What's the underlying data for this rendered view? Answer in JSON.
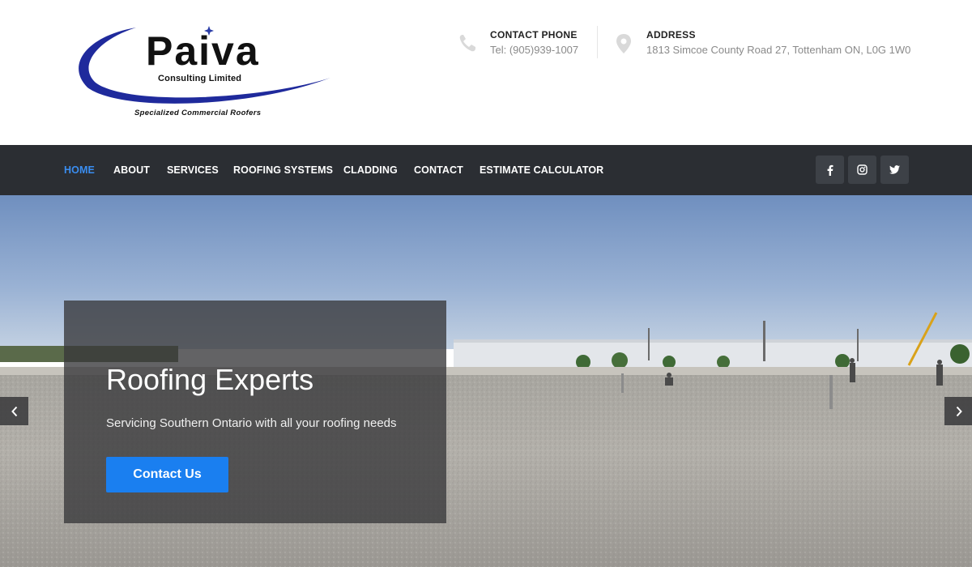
{
  "logo": {
    "brand": "Paiva",
    "subtitle": "Consulting Limited",
    "tagline": "Specialized Commercial Roofers",
    "swoosh_color": "#1f2a9c",
    "icon": "paiva-logo-swoosh"
  },
  "header": {
    "phone": {
      "label": "CONTACT PHONE",
      "value": "Tel: (905)939-1007",
      "icon": "phone-icon"
    },
    "address": {
      "label": "ADDRESS",
      "value": "1813 Simcoe County Road 27, Tottenham ON, L0G 1W0",
      "icon": "map-pin-icon"
    }
  },
  "nav": {
    "items": [
      {
        "label": "HOME",
        "active": true
      },
      {
        "label": "ABOUT"
      },
      {
        "label": "SERVICES"
      },
      {
        "label": "ROOFING SYSTEMS"
      },
      {
        "label": "CLADDING"
      },
      {
        "label": "CONTACT"
      },
      {
        "label": "ESTIMATE CALCULATOR"
      }
    ],
    "social": [
      {
        "icon": "facebook-icon"
      },
      {
        "icon": "instagram-icon"
      },
      {
        "icon": "twitter-icon"
      }
    ],
    "active_color": "#3a8df0",
    "background": "#2b2e33"
  },
  "hero": {
    "title": "Roofing Experts",
    "subtitle": "Servicing Southern Ontario with all your roofing needs",
    "cta_label": "Contact Us",
    "cta_color": "#1a7ff0",
    "prev_icon": "chevron-left-icon",
    "next_icon": "chevron-right-icon"
  }
}
